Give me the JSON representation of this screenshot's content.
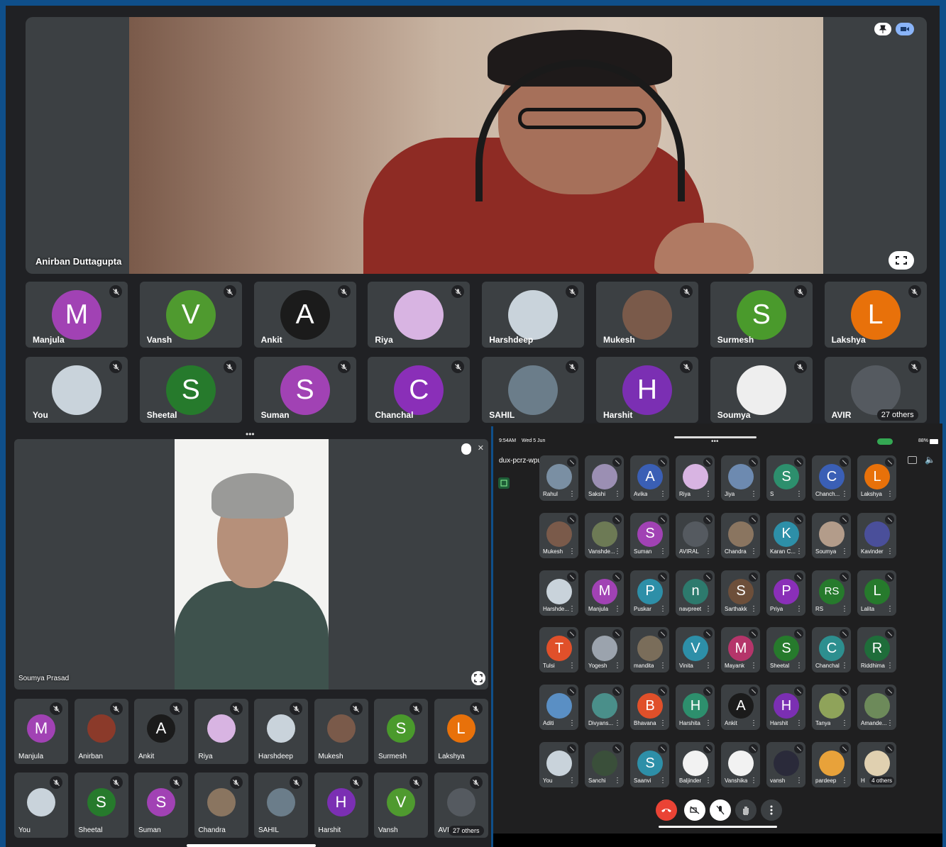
{
  "top": {
    "speaker_name": "Anirban Duttagupta",
    "tiles": [
      {
        "name": "Manjula",
        "initial": "M",
        "color": "#a142b4"
      },
      {
        "name": "Vansh",
        "initial": "V",
        "color": "#4f9a2f"
      },
      {
        "name": "Ankit",
        "initial": "A",
        "color": "#1b1b1b"
      },
      {
        "name": "Riya",
        "initial": "",
        "color": "#d8b4e2"
      },
      {
        "name": "Harshdeep",
        "initial": "",
        "color": "#c9d3db"
      },
      {
        "name": "Mukesh",
        "initial": "",
        "color": "#7a5a4a"
      },
      {
        "name": "Surmesh",
        "initial": "S",
        "color": "#4a9a2c"
      },
      {
        "name": "Lakshya",
        "initial": "L",
        "color": "#e8710a"
      },
      {
        "name": "You",
        "initial": "",
        "color": "#c9d3db"
      },
      {
        "name": "Sheetal",
        "initial": "S",
        "color": "#267a2c"
      },
      {
        "name": "Suman",
        "initial": "S",
        "color": "#a142b4"
      },
      {
        "name": "Chanchal",
        "initial": "C",
        "color": "#8a2fb8"
      },
      {
        "name": "SAHIL",
        "initial": "",
        "color": "#6b7d8a"
      },
      {
        "name": "Harshit",
        "initial": "H",
        "color": "#7b2fb3"
      },
      {
        "name": "Soumya",
        "initial": "",
        "color": "#eeeeee"
      },
      {
        "name": "AVIR",
        "initial": "",
        "color": "#555a60",
        "others": "27 others"
      }
    ]
  },
  "bottom_left": {
    "speaker_name": "Soumya Prasad",
    "tiles": [
      {
        "name": "Manjula",
        "initial": "M",
        "color": "#a142b4"
      },
      {
        "name": "Anirban",
        "initial": "",
        "color": "#8b3a2a"
      },
      {
        "name": "Ankit",
        "initial": "A",
        "color": "#1b1b1b"
      },
      {
        "name": "Riya",
        "initial": "",
        "color": "#d8b4e2"
      },
      {
        "name": "Harshdeep",
        "initial": "",
        "color": "#c9d3db"
      },
      {
        "name": "Mukesh",
        "initial": "",
        "color": "#7a5a4a"
      },
      {
        "name": "Surmesh",
        "initial": "S",
        "color": "#4a9a2c"
      },
      {
        "name": "Lakshya",
        "initial": "L",
        "color": "#e8710a"
      },
      {
        "name": "You",
        "initial": "",
        "color": "#c9d3db"
      },
      {
        "name": "Sheetal",
        "initial": "S",
        "color": "#267a2c"
      },
      {
        "name": "Suman",
        "initial": "S",
        "color": "#a142b4"
      },
      {
        "name": "Chandra",
        "initial": "",
        "color": "#8a7560"
      },
      {
        "name": "SAHIL",
        "initial": "",
        "color": "#6b7d8a"
      },
      {
        "name": "Harshit",
        "initial": "H",
        "color": "#7b2fb3"
      },
      {
        "name": "Vansh",
        "initial": "V",
        "color": "#4f9a2f"
      },
      {
        "name": "AVIR",
        "initial": "",
        "color": "#555a60",
        "others": "27 others"
      }
    ]
  },
  "tablet": {
    "time": "9:54AM",
    "date": "Wed 5 Jun",
    "battery": "88%",
    "meeting_code": "dux-pcrz-wpu",
    "participants": [
      {
        "name": "Rahul",
        "initial": "",
        "color": "#7a8fa3"
      },
      {
        "name": "Sakshi",
        "initial": "",
        "color": "#9b8fb3"
      },
      {
        "name": "Avika",
        "initial": "A",
        "color": "#3a5fb5"
      },
      {
        "name": "Riya",
        "initial": "",
        "color": "#d8b4e2"
      },
      {
        "name": "Jiya",
        "initial": "",
        "color": "#6d8ab0"
      },
      {
        "name": "S",
        "initial": "S",
        "color": "#2d8f6d"
      },
      {
        "name": "Chanch...",
        "initial": "C",
        "color": "#3a5fb5"
      },
      {
        "name": "Lakshya",
        "initial": "L",
        "color": "#e8710a"
      },
      {
        "name": "Mukesh",
        "initial": "",
        "color": "#7a5a4a"
      },
      {
        "name": "Vanshde...",
        "initial": "",
        "color": "#6d7a55"
      },
      {
        "name": "Suman",
        "initial": "S",
        "color": "#a142b4"
      },
      {
        "name": "AVIRAL",
        "initial": "",
        "color": "#555a60"
      },
      {
        "name": "Chandra",
        "initial": "",
        "color": "#8a7560"
      },
      {
        "name": "Karan C...",
        "initial": "K",
        "color": "#2d8fa8"
      },
      {
        "name": "Soumya",
        "initial": "",
        "color": "#b39c8a"
      },
      {
        "name": "Kavinder",
        "initial": "",
        "color": "#4a4f9a"
      },
      {
        "name": "Harshde...",
        "initial": "",
        "color": "#c9d3db"
      },
      {
        "name": "Manjula",
        "initial": "M",
        "color": "#a142b4"
      },
      {
        "name": "Puskar",
        "initial": "P",
        "color": "#2d8fa8"
      },
      {
        "name": "navpreet",
        "initial": "n",
        "color": "#2d7a6d"
      },
      {
        "name": "Sarthakk",
        "initial": "S",
        "color": "#6d4f3a"
      },
      {
        "name": "Priya",
        "initial": "P",
        "color": "#8a2fb8"
      },
      {
        "name": "RS",
        "initial": "RS",
        "color": "#267a2c"
      },
      {
        "name": "Lalita",
        "initial": "L",
        "color": "#267a2c"
      },
      {
        "name": "Tulsi",
        "initial": "T",
        "color": "#e0502a"
      },
      {
        "name": "Yogesh",
        "initial": "",
        "color": "#9ba3ad"
      },
      {
        "name": "mandita",
        "initial": "",
        "color": "#7a6d5a"
      },
      {
        "name": "Vinita",
        "initial": "V",
        "color": "#2d8fa8"
      },
      {
        "name": "Mayank",
        "initial": "M",
        "color": "#b5356a"
      },
      {
        "name": "Sheetal",
        "initial": "S",
        "color": "#267a2c"
      },
      {
        "name": "Chanchal",
        "initial": "C",
        "color": "#2d8f8f"
      },
      {
        "name": "Riddhima",
        "initial": "R",
        "color": "#1f6d3a"
      },
      {
        "name": "Aditi",
        "initial": "",
        "color": "#5a8fc4"
      },
      {
        "name": "Divyans...",
        "initial": "",
        "color": "#4a8f8a"
      },
      {
        "name": "Bhavana",
        "initial": "B",
        "color": "#e0502a"
      },
      {
        "name": "Harshita",
        "initial": "H",
        "color": "#2d8f6d"
      },
      {
        "name": "Ankit",
        "initial": "A",
        "color": "#1b1b1b"
      },
      {
        "name": "Harshit",
        "initial": "H",
        "color": "#7b2fb3"
      },
      {
        "name": "Tanya",
        "initial": "",
        "color": "#8fa35a"
      },
      {
        "name": "Amande...",
        "initial": "",
        "color": "#6d8a5a"
      },
      {
        "name": "You",
        "initial": "",
        "color": "#c9d3db"
      },
      {
        "name": "Sanchi",
        "initial": "",
        "color": "#3a4f3a"
      },
      {
        "name": "Saanvi",
        "initial": "S",
        "color": "#2d8fa8"
      },
      {
        "name": "Baljinder",
        "initial": "",
        "color": "#f2f2f2"
      },
      {
        "name": "Vanshika",
        "initial": "",
        "color": "#f2f2f2"
      },
      {
        "name": "vansh",
        "initial": "",
        "color": "#2a2a3a"
      },
      {
        "name": "pardeep",
        "initial": "",
        "color": "#e8a23a"
      },
      {
        "name": "H",
        "initial": "",
        "color": "#e0d0b0",
        "others": "4 others"
      }
    ]
  }
}
